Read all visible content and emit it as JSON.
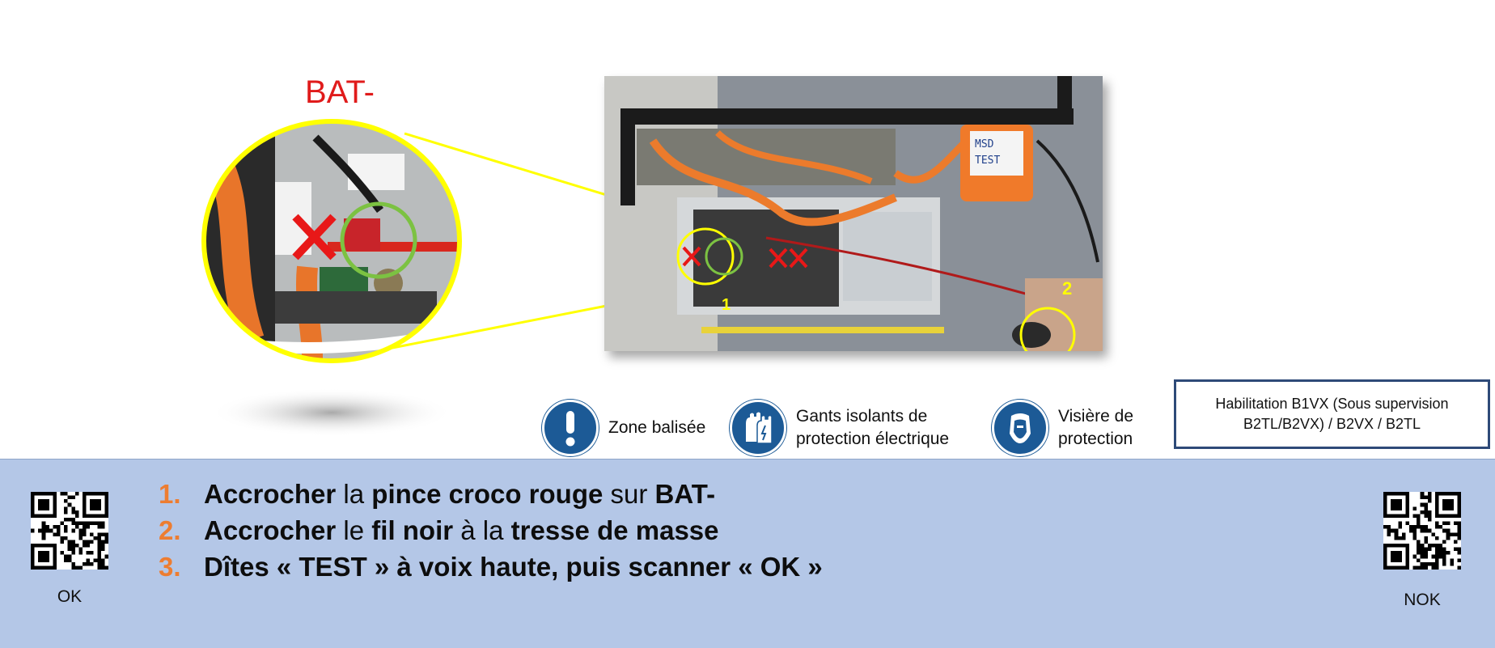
{
  "zoom": {
    "title": "BAT-"
  },
  "photo": {
    "label_1": "1",
    "label_2": "2",
    "tag": "MSD\nTEST"
  },
  "ppe": [
    {
      "icon": "exclamation-icon",
      "label_line1": "Zone balisée",
      "label_line2": ""
    },
    {
      "icon": "insulated-gloves-icon",
      "label_line1": "Gants isolants de",
      "label_line2": "protection électrique"
    },
    {
      "icon": "face-visor-icon",
      "label_line1": "Visière de",
      "label_line2": "protection"
    }
  ],
  "habilitation": {
    "line1": "Habilitation B1VX (Sous supervision",
    "line2": "B2TL/B2VX) / B2VX / B2TL"
  },
  "steps": [
    {
      "num": "1.",
      "parts": [
        "Accrocher",
        " la ",
        "pince croco rouge",
        " sur ",
        "BAT-"
      ]
    },
    {
      "num": "2.",
      "parts": [
        "Accrocher",
        " le ",
        "fil noir",
        " à la ",
        "tresse de masse"
      ]
    },
    {
      "num": "3.",
      "parts": [
        "Dîtes « TEST » à voix haute, puis scanner « OK »"
      ]
    }
  ],
  "qr": {
    "ok_label": "OK",
    "nok_label": "NOK"
  },
  "colors": {
    "accent": "#ed7d31",
    "panel": "#b4c7e7",
    "alert": "#e01b1b",
    "highlight": "#ffff00",
    "ok_ring": "#7cc242",
    "ppe_blue": "#1c5a96"
  }
}
